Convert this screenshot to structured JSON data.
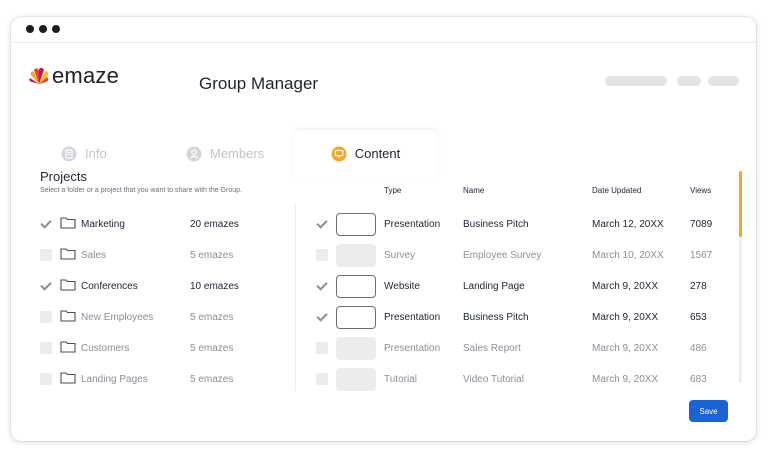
{
  "header": {
    "logo_text": "emaze",
    "title": "Group Manager"
  },
  "tabs": [
    {
      "label": "Info",
      "icon": "document-icon",
      "active": false
    },
    {
      "label": "Members",
      "icon": "user-icon",
      "active": false
    },
    {
      "label": "Content",
      "icon": "presentation-icon",
      "active": true
    }
  ],
  "projects": {
    "title": "Projects",
    "subtitle": "Select a folder or a project that you want to share with the Group.",
    "folders": [
      {
        "name": "Marketing",
        "count": "20 emazes",
        "checked": true
      },
      {
        "name": "Sales",
        "count": "5 emazes",
        "checked": false
      },
      {
        "name": "Conferences",
        "count": "10 emazes",
        "checked": true
      },
      {
        "name": "New Employees",
        "count": "5 emazes",
        "checked": false
      },
      {
        "name": "Customers",
        "count": "5 emazes",
        "checked": false
      },
      {
        "name": "Landing Pages",
        "count": "5 emazes",
        "checked": false
      }
    ]
  },
  "table": {
    "headers": {
      "type": "Type",
      "name": "Name",
      "date": "Date Updated",
      "views": "Views"
    },
    "rows": [
      {
        "type": "Presentation",
        "name": "Business Pitch",
        "date": "March 12, 20XX",
        "views": "7089",
        "checked": true
      },
      {
        "type": "Survey",
        "name": "Employee Survey",
        "date": "March 10, 20XX",
        "views": "1567",
        "checked": false
      },
      {
        "type": "Website",
        "name": "Landing Page",
        "date": "March 9, 20XX",
        "views": "278",
        "checked": true
      },
      {
        "type": "Presentation",
        "name": "Business Pitch",
        "date": "March 9, 20XX",
        "views": "653",
        "checked": true
      },
      {
        "type": "Presentation",
        "name": "Sales Report",
        "date": "March 9, 20XX",
        "views": "486",
        "checked": false
      },
      {
        "type": "Tutorial",
        "name": "Video Tutorial",
        "date": "March 9, 20XX",
        "views": "683",
        "checked": false
      }
    ]
  },
  "actions": {
    "save_label": "Save"
  },
  "colors": {
    "accent": "#f5a623",
    "primary": "#1a63d4"
  }
}
